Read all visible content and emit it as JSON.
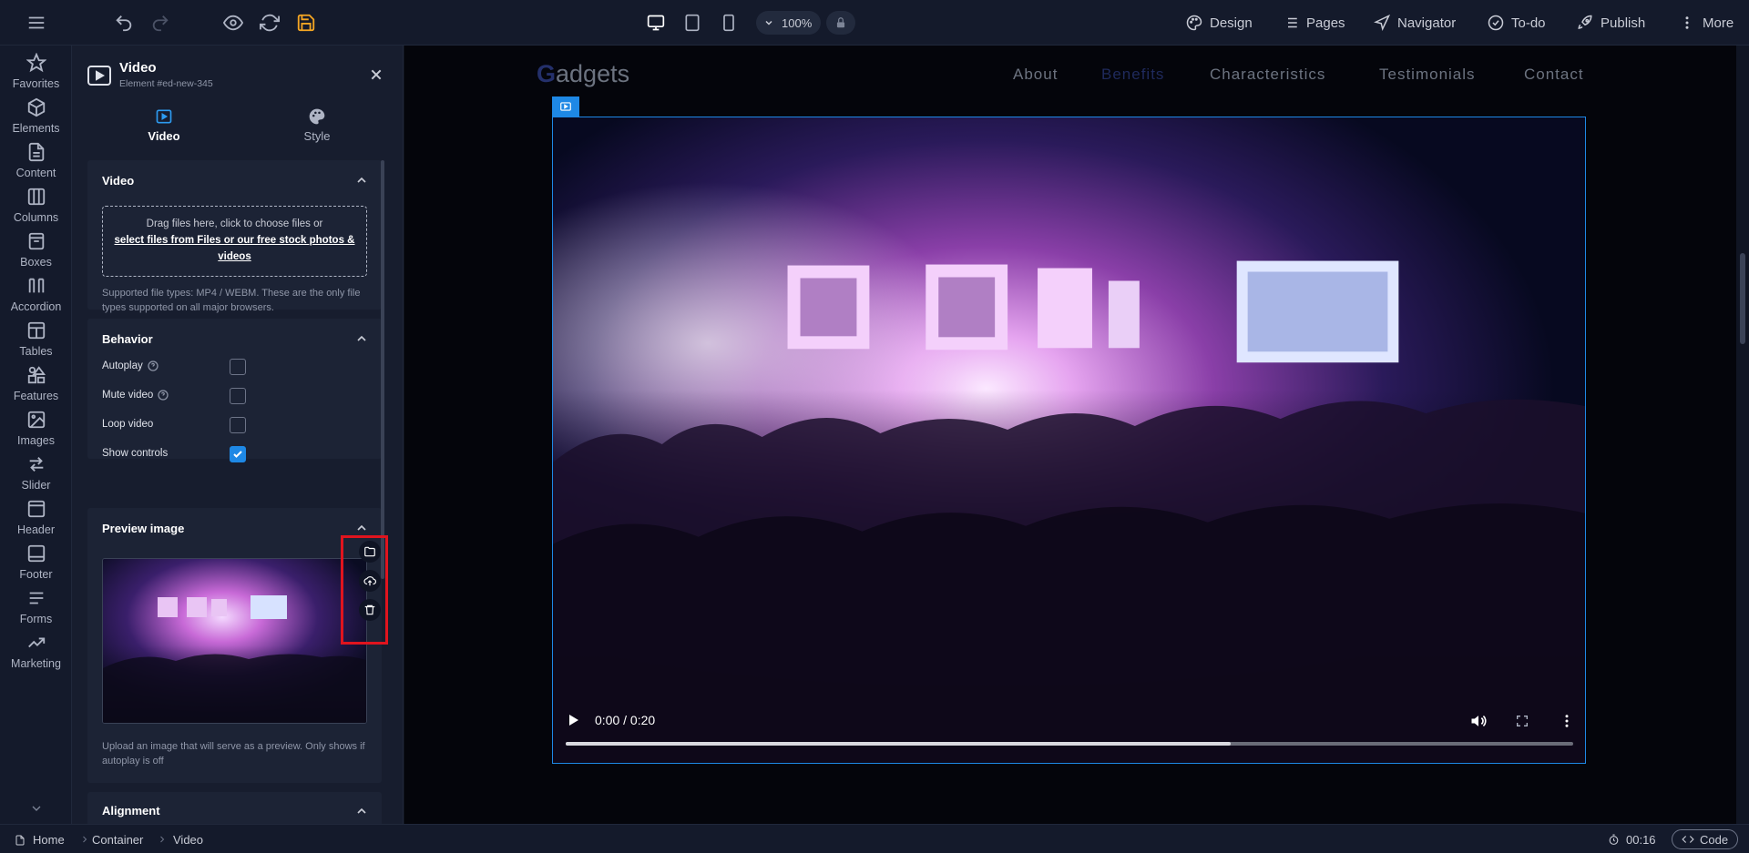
{
  "topbar": {
    "zoom": "100%",
    "menu": {
      "design": "Design",
      "pages": "Pages",
      "navigator": "Navigator",
      "todo": "To-do",
      "publish": "Publish",
      "more": "More"
    },
    "save_icon_color": "#f5a623"
  },
  "rail": {
    "items": [
      {
        "label": "Favorites",
        "icon": "star-icon"
      },
      {
        "label": "Elements",
        "icon": "cube-icon"
      },
      {
        "label": "Content",
        "icon": "document-icon"
      },
      {
        "label": "Columns",
        "icon": "columns-icon"
      },
      {
        "label": "Boxes",
        "icon": "box-icon"
      },
      {
        "label": "Accordion",
        "icon": "accordion-icon"
      },
      {
        "label": "Tables",
        "icon": "table-icon"
      },
      {
        "label": "Features",
        "icon": "features-icon"
      },
      {
        "label": "Images",
        "icon": "image-icon"
      },
      {
        "label": "Slider",
        "icon": "slider-icon"
      },
      {
        "label": "Header",
        "icon": "header-icon"
      },
      {
        "label": "Footer",
        "icon": "footer-icon"
      },
      {
        "label": "Forms",
        "icon": "forms-icon"
      },
      {
        "label": "Marketing",
        "icon": "trend-icon"
      }
    ]
  },
  "panel": {
    "title": "Video",
    "subtitle": "Element #ed-new-345",
    "tabs": [
      {
        "label": "Video"
      },
      {
        "label": "Style"
      }
    ],
    "video_section": {
      "title": "Video",
      "dropzone_text": "Drag files here, click to choose files or",
      "dropzone_link": "select files from Files or our free stock photos & videos",
      "help": "Supported file types: MP4 / WEBM. These are the only file types supported on all major browsers."
    },
    "behavior": {
      "title": "Behavior",
      "autoplay": {
        "label": "Autoplay",
        "checked": false
      },
      "mute": {
        "label": "Mute video",
        "checked": false
      },
      "loop": {
        "label": "Loop video",
        "checked": false
      },
      "controls": {
        "label": "Show controls",
        "checked": true
      }
    },
    "preview": {
      "title": "Preview image",
      "help": "Upload an image that will serve as a preview. Only shows if autoplay is off"
    },
    "alignment": {
      "title": "Alignment"
    }
  },
  "site": {
    "logo_first": "G",
    "logo_rest": "adgets",
    "nav": [
      "About",
      "Benefits",
      "Characteristics",
      "Testimonials",
      "Contact"
    ],
    "nav_current": "Benefits"
  },
  "video_player": {
    "time": "0:00 / 0:20",
    "progress_fraction": 0.66
  },
  "bottombar": {
    "breadcrumbs": [
      "Home",
      "Container",
      "Video"
    ],
    "timer": "00:16",
    "code": "Code"
  },
  "colors": {
    "accent": "#1e88e5",
    "highlight": "#e0141e"
  }
}
